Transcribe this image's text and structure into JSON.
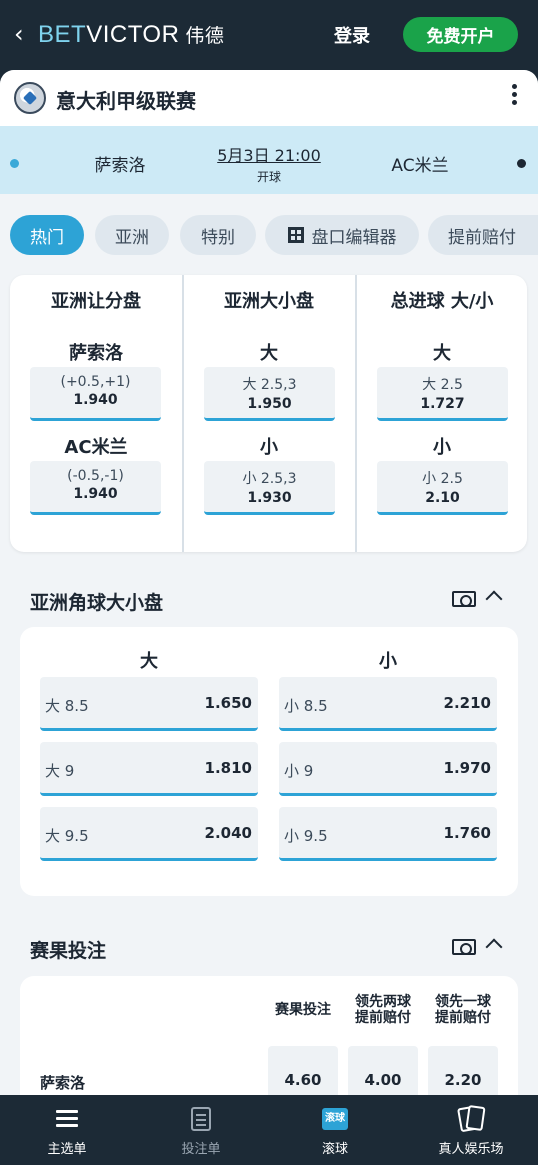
{
  "header": {
    "logo_bet": "BET",
    "logo_victor": "VICTOR",
    "logo_cn": "伟德",
    "login": "登录",
    "register": "免费开户"
  },
  "league": {
    "title": "意大利甲级联赛"
  },
  "match": {
    "home": "萨索洛",
    "away": "AC米兰",
    "kickoff": "5月3日 21:00",
    "kickoff_label": "开球"
  },
  "tabs": [
    "热门",
    "亚洲",
    "特别",
    "盘口编辑器",
    "提前赔付"
  ],
  "handicap": {
    "columns": [
      {
        "title": "亚洲让分盘",
        "rows": [
          {
            "label": "萨索洛",
            "line": "(+0.5,+1)",
            "odds": "1.940"
          },
          {
            "label": "AC米兰",
            "line": "(-0.5,-1)",
            "odds": "1.940"
          }
        ]
      },
      {
        "title": "亚洲大小盘",
        "rows": [
          {
            "label": "大",
            "line": "大 2.5,3",
            "odds": "1.950"
          },
          {
            "label": "小",
            "line": "小 2.5,3",
            "odds": "1.930"
          }
        ]
      },
      {
        "title": "总进球 大/小",
        "rows": [
          {
            "label": "大",
            "line": "大 2.5",
            "odds": "1.727"
          },
          {
            "label": "小",
            "line": "小 2.5",
            "odds": "2.10"
          }
        ]
      }
    ]
  },
  "corners": {
    "title": "亚洲角球大小盘",
    "over_header": "大",
    "under_header": "小",
    "over": [
      {
        "line": "大 8.5",
        "odds": "1.650"
      },
      {
        "line": "大 9",
        "odds": "1.810"
      },
      {
        "line": "大 9.5",
        "odds": "2.040"
      }
    ],
    "under": [
      {
        "line": "小 8.5",
        "odds": "2.210"
      },
      {
        "line": "小 9",
        "odds": "1.970"
      },
      {
        "line": "小 9.5",
        "odds": "1.760"
      }
    ]
  },
  "result": {
    "title": "赛果投注",
    "headers": [
      "赛果投注",
      "领先两球\n提前赔付",
      "领先一球\n提前赔付"
    ],
    "team": "萨索洛",
    "odds": [
      "4.60",
      "4.00",
      "2.20"
    ]
  },
  "bottom_nav": {
    "items": [
      {
        "label": "主选单",
        "icon": "menu-icon"
      },
      {
        "label": "投注单",
        "icon": "betslip-icon"
      },
      {
        "label": "滚球",
        "icon": "live-icon",
        "badge": "滚球"
      },
      {
        "label": "真人娱乐场",
        "icon": "cards-icon"
      }
    ]
  },
  "colors": {
    "header_bg": "#1c2a36",
    "accent": "#2da3d6",
    "register_green": "#1aa34a",
    "match_bar_bg": "#cdeaf6"
  }
}
